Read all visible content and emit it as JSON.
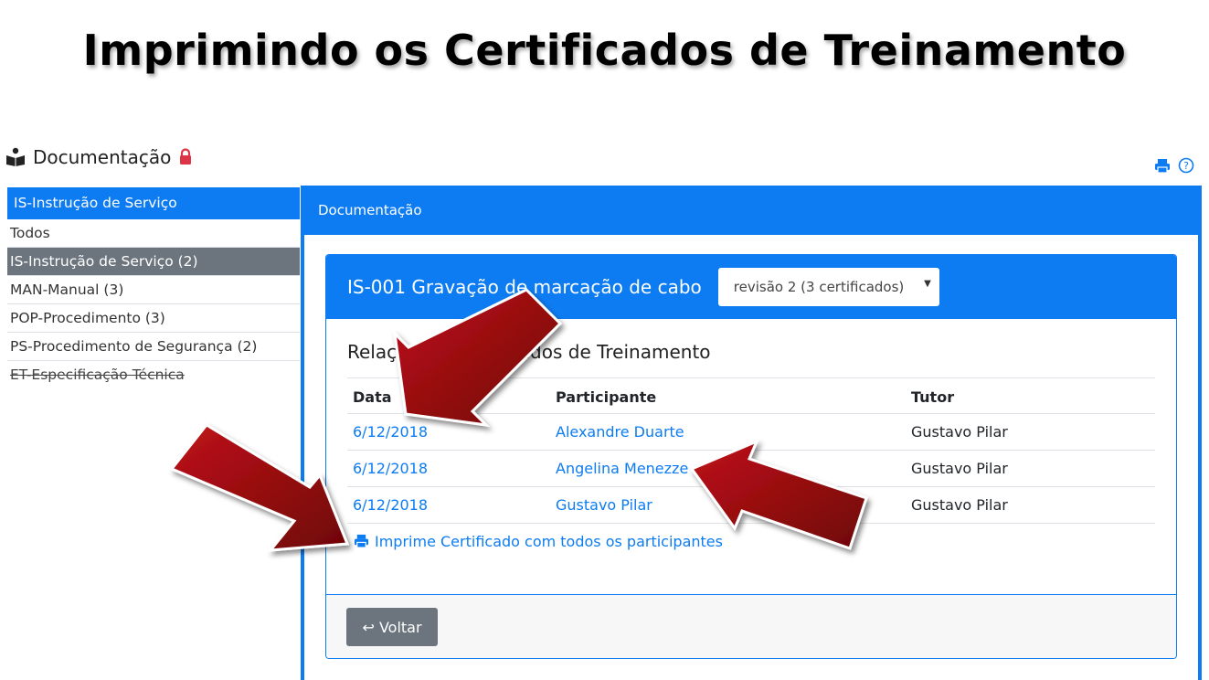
{
  "slide_title": "Imprimindo os Certificados de Treinamento",
  "header": {
    "title": "Documentação",
    "icons": [
      "book-reader-icon",
      "lock-icon",
      "print-icon",
      "help-icon"
    ]
  },
  "sidebar": {
    "head": "IS-Instrução de Serviço",
    "items": [
      {
        "label": "Todos"
      },
      {
        "label": "IS-Instrução de Serviço (2)"
      },
      {
        "label": "MAN-Manual (3)"
      },
      {
        "label": "POP-Procedimento (3)"
      },
      {
        "label": "PS-Procedimento de Segurança (2)"
      },
      {
        "label": "ET-Especificação Técnica"
      }
    ]
  },
  "main": {
    "breadcrumb": "Documentação",
    "doc_title": "IS-001 Gravação de marcação de cabo",
    "revision_select": "revisão 2 (3 certificados)",
    "section_title": "Relação de Certificados de Treinamento",
    "columns": [
      "Data",
      "Participante",
      "Tutor"
    ],
    "rows": [
      {
        "date": "6/12/2018",
        "participant": "Alexandre Duarte",
        "tutor": "Gustavo Pilar"
      },
      {
        "date": "6/12/2018",
        "participant": "Angelina Menezze",
        "tutor": "Gustavo Pilar"
      },
      {
        "date": "6/12/2018",
        "participant": "Gustavo Pilar",
        "tutor": "Gustavo Pilar"
      }
    ],
    "print_all_label": "Imprime Certificado com todos os participantes",
    "back_button": "↩ Voltar"
  },
  "colors": {
    "accent": "#0d7cf2",
    "active_item": "#6c757d",
    "arrow": "#9b0b0b",
    "lock": "#dc3545"
  }
}
